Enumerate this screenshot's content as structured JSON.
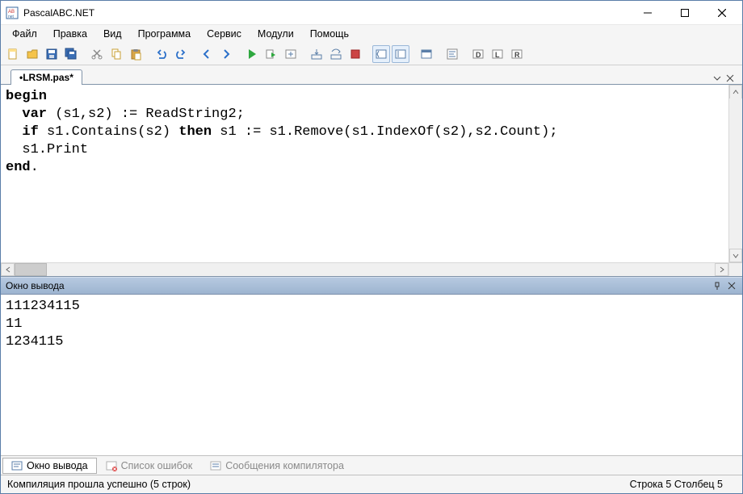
{
  "title": "PascalABC.NET",
  "menus": [
    "Файл",
    "Правка",
    "Вид",
    "Программа",
    "Сервис",
    "Модули",
    "Помощь"
  ],
  "tab": "•LRSM.pas*",
  "code": {
    "l1_kw": "begin",
    "l2_pre": "  ",
    "l2_kw": "var",
    "l2_rest": " (s1,s2) := ReadString2;",
    "l3_pre": "  ",
    "l3_kw1": "if",
    "l3_mid": " s1.Contains(s2) ",
    "l3_kw2": "then",
    "l3_rest": " s1 := s1.Remove(s1.IndexOf(s2),s2.Count);",
    "l4": "  s1.Print",
    "l5_kw": "end",
    "l5_rest": "."
  },
  "output_panel_title": "Окно вывода",
  "output_lines": "111234115\n11\n1234115",
  "bottom_tabs": {
    "t1": "Окно вывода",
    "t2": "Список ошибок",
    "t3": "Сообщения компилятора"
  },
  "status": {
    "msg": "Компиляция прошла успешно (5 строк)",
    "pos": "Строка  5  Столбец  5"
  }
}
